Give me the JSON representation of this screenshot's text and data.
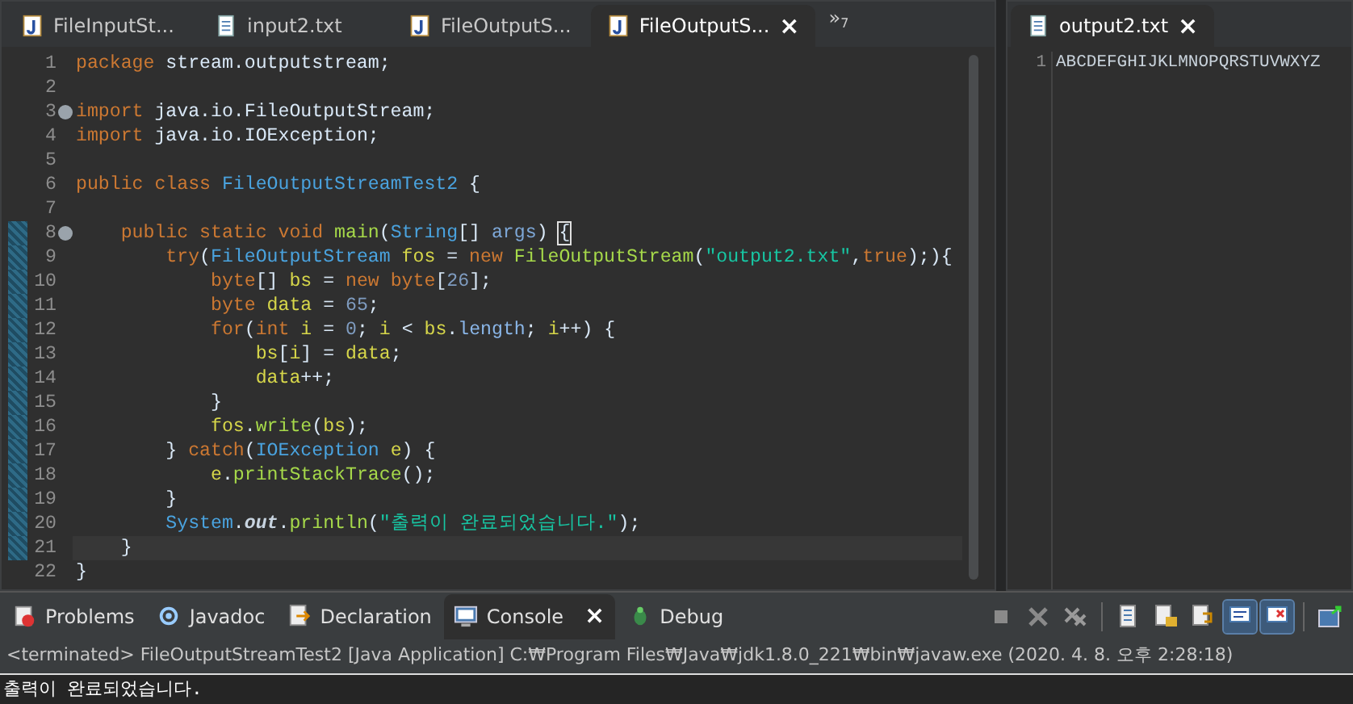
{
  "editor_tabs": [
    {
      "label": "FileInputSt...",
      "kind": "java",
      "selected": false
    },
    {
      "label": "input2.txt",
      "kind": "text",
      "selected": false
    },
    {
      "label": "FileOutputS...",
      "kind": "java",
      "selected": false
    },
    {
      "label": "FileOutputS...",
      "kind": "java",
      "selected": true,
      "close": "×"
    }
  ],
  "overflow": {
    "symbol": "»",
    "count": "7"
  },
  "editor": {
    "lines": [
      {
        "number": "1",
        "changed": false,
        "current": false,
        "fold": false,
        "tokens": [
          {
            "text": "package",
            "kind": "kw"
          },
          {
            "text": " stream.outputstream;",
            "kind": "plain"
          }
        ]
      },
      {
        "number": "2",
        "changed": false,
        "current": false,
        "fold": false
      },
      {
        "number": "3",
        "changed": false,
        "current": false,
        "fold": true,
        "tokens": [
          {
            "text": "import",
            "kind": "kw"
          },
          {
            "text": " java.io.FileOutputStream;",
            "kind": "plain"
          }
        ]
      },
      {
        "number": "4",
        "changed": false,
        "current": false,
        "fold": false,
        "tokens": [
          {
            "text": "import",
            "kind": "kw"
          },
          {
            "text": " java.io.IOException;",
            "kind": "plain"
          }
        ]
      },
      {
        "number": "5",
        "changed": false,
        "current": false,
        "fold": false
      },
      {
        "number": "6",
        "changed": false,
        "current": false,
        "fold": false,
        "tokens": [
          {
            "text": "public",
            "kind": "kw"
          },
          {
            "text": " class",
            "kind": "kw"
          },
          {
            "text": " FileOutputStreamTest2",
            "kind": "type"
          },
          {
            "text": " {",
            "kind": "plain"
          }
        ]
      },
      {
        "number": "7",
        "changed": false,
        "current": false,
        "fold": false
      },
      {
        "number": "8",
        "changed": true,
        "current": false,
        "fold": true,
        "tokens": [
          {
            "text": "    public",
            "kind": "kw"
          },
          {
            "text": " static",
            "kind": "kw"
          },
          {
            "text": " void",
            "kind": "kw"
          },
          {
            "text": " main",
            "kind": "fn"
          },
          {
            "text": "(",
            "kind": "plain"
          },
          {
            "text": "String",
            "kind": "type"
          },
          {
            "text": "[]",
            "kind": "plain"
          },
          {
            "text": " args",
            "kind": "param"
          },
          {
            "text": ") ",
            "kind": "plain"
          },
          {
            "text": "{",
            "kind": "match"
          }
        ]
      },
      {
        "number": "9",
        "changed": true,
        "current": false,
        "fold": false,
        "tokens": [
          {
            "text": "        try",
            "kind": "kw"
          },
          {
            "text": "(",
            "kind": "plain"
          },
          {
            "text": "FileOutputStream",
            "kind": "type"
          },
          {
            "text": " fos",
            "kind": "var"
          },
          {
            "text": " =",
            "kind": "plain"
          },
          {
            "text": " new",
            "kind": "kw"
          },
          {
            "text": " FileOutputStream",
            "kind": "fn"
          },
          {
            "text": "(",
            "kind": "plain"
          },
          {
            "text": "\"output2.txt\"",
            "kind": "str"
          },
          {
            "text": ",",
            "kind": "plain"
          },
          {
            "text": "true",
            "kind": "kw"
          },
          {
            "text": ");){",
            "kind": "plain"
          }
        ]
      },
      {
        "number": "10",
        "changed": true,
        "current": false,
        "fold": false,
        "tokens": [
          {
            "text": "            byte",
            "kind": "kw"
          },
          {
            "text": "[]",
            "kind": "plain"
          },
          {
            "text": " bs",
            "kind": "var"
          },
          {
            "text": " =",
            "kind": "plain"
          },
          {
            "text": " new",
            "kind": "kw"
          },
          {
            "text": " byte",
            "kind": "kw"
          },
          {
            "text": "[",
            "kind": "plain"
          },
          {
            "text": "26",
            "kind": "num"
          },
          {
            "text": "];",
            "kind": "plain"
          }
        ]
      },
      {
        "number": "11",
        "changed": true,
        "current": false,
        "fold": false,
        "tokens": [
          {
            "text": "            byte",
            "kind": "kw"
          },
          {
            "text": " data",
            "kind": "var"
          },
          {
            "text": " =",
            "kind": "plain"
          },
          {
            "text": " 65",
            "kind": "num"
          },
          {
            "text": ";",
            "kind": "plain"
          }
        ]
      },
      {
        "number": "12",
        "changed": true,
        "current": false,
        "fold": false,
        "tokens": [
          {
            "text": "            for",
            "kind": "kw"
          },
          {
            "text": "(",
            "kind": "plain"
          },
          {
            "text": "int",
            "kind": "kw"
          },
          {
            "text": " i",
            "kind": "var"
          },
          {
            "text": " =",
            "kind": "plain"
          },
          {
            "text": " 0",
            "kind": "num"
          },
          {
            "text": ";",
            "kind": "plain"
          },
          {
            "text": " i",
            "kind": "var"
          },
          {
            "text": " <",
            "kind": "plain"
          },
          {
            "text": " bs",
            "kind": "var"
          },
          {
            "text": ".",
            "kind": "plain"
          },
          {
            "text": "length",
            "kind": "field"
          },
          {
            "text": ";",
            "kind": "plain"
          },
          {
            "text": " i",
            "kind": "var"
          },
          {
            "text": "++) {",
            "kind": "plain"
          }
        ]
      },
      {
        "number": "13",
        "changed": true,
        "current": false,
        "fold": false,
        "tokens": [
          {
            "text": "                bs",
            "kind": "var"
          },
          {
            "text": "[",
            "kind": "plain"
          },
          {
            "text": "i",
            "kind": "var"
          },
          {
            "text": "] =",
            "kind": "plain"
          },
          {
            "text": " data",
            "kind": "var"
          },
          {
            "text": ";",
            "kind": "plain"
          }
        ]
      },
      {
        "number": "14",
        "changed": true,
        "current": false,
        "fold": false,
        "tokens": [
          {
            "text": "                data",
            "kind": "var"
          },
          {
            "text": "++;",
            "kind": "plain"
          }
        ]
      },
      {
        "number": "15",
        "changed": true,
        "current": false,
        "fold": false,
        "tokens": [
          {
            "text": "            }",
            "kind": "plain"
          }
        ]
      },
      {
        "number": "16",
        "changed": true,
        "current": false,
        "fold": false,
        "tokens": [
          {
            "text": "            fos",
            "kind": "var"
          },
          {
            "text": ".",
            "kind": "plain"
          },
          {
            "text": "write",
            "kind": "fn"
          },
          {
            "text": "(",
            "kind": "plain"
          },
          {
            "text": "bs",
            "kind": "var"
          },
          {
            "text": ");",
            "kind": "plain"
          }
        ]
      },
      {
        "number": "17",
        "changed": true,
        "current": false,
        "fold": false,
        "tokens": [
          {
            "text": "        }",
            "kind": "plain"
          },
          {
            "text": " catch",
            "kind": "kw"
          },
          {
            "text": "(",
            "kind": "plain"
          },
          {
            "text": "IOException",
            "kind": "type"
          },
          {
            "text": " e",
            "kind": "var"
          },
          {
            "text": ") {",
            "kind": "plain"
          }
        ]
      },
      {
        "number": "18",
        "changed": true,
        "current": false,
        "fold": false,
        "tokens": [
          {
            "text": "            e",
            "kind": "var"
          },
          {
            "text": ".",
            "kind": "plain"
          },
          {
            "text": "printStackTrace",
            "kind": "fn"
          },
          {
            "text": "();",
            "kind": "plain"
          }
        ]
      },
      {
        "number": "19",
        "changed": true,
        "current": false,
        "fold": false,
        "tokens": [
          {
            "text": "        }",
            "kind": "plain"
          }
        ]
      },
      {
        "number": "20",
        "changed": true,
        "current": false,
        "fold": false,
        "tokens": [
          {
            "text": "        System",
            "kind": "type"
          },
          {
            "text": ".",
            "kind": "plain"
          },
          {
            "text": "out",
            "kind": "static"
          },
          {
            "text": ".",
            "kind": "plain"
          },
          {
            "text": "println",
            "kind": "fn"
          },
          {
            "text": "(",
            "kind": "plain"
          },
          {
            "text": "\"출력이 완료되었습니다.\"",
            "kind": "str"
          },
          {
            "text": ");",
            "kind": "plain"
          }
        ]
      },
      {
        "number": "21",
        "changed": true,
        "current": true,
        "fold": false,
        "tokens": [
          {
            "text": "    }",
            "kind": "plain"
          }
        ]
      },
      {
        "number": "22",
        "changed": false,
        "current": false,
        "fold": false,
        "tokens": [
          {
            "text": "}",
            "kind": "plain"
          }
        ]
      }
    ]
  },
  "side_tab": {
    "label": "output2.txt",
    "selected": true,
    "close": "×"
  },
  "side_editor": {
    "lines": [
      {
        "number": "1",
        "text": "ABCDEFGHIJKLMNOPQRSTUVWXYZ"
      }
    ]
  },
  "bottom_tabs": [
    {
      "label": "Problems",
      "kind": "problems",
      "selected": false
    },
    {
      "label": "Javadoc",
      "kind": "javadoc",
      "selected": false
    },
    {
      "label": "Declaration",
      "kind": "declaration",
      "selected": false
    },
    {
      "label": "Console",
      "kind": "console",
      "selected": true,
      "close": "×"
    },
    {
      "label": "Debug",
      "kind": "debug",
      "selected": false
    }
  ],
  "console_toolbar": [
    {
      "kind": "stop",
      "pressed": false
    },
    {
      "kind": "remove",
      "pressed": false
    },
    {
      "kind": "remove-all",
      "pressed": false
    },
    {
      "kind": "doc",
      "pressed": false
    },
    {
      "kind": "lock",
      "pressed": false
    },
    {
      "kind": "word-wrap",
      "pressed": false
    },
    {
      "kind": "show-out",
      "pressed": true
    },
    {
      "kind": "show-err",
      "pressed": true
    },
    {
      "kind": "open",
      "pressed": false
    }
  ],
  "console": {
    "header": "<terminated> FileOutputStreamTest2 [Java Application] C:₩Program Files₩Java₩jdk1.8.0_221₩bin₩javaw.exe (2020. 4. 8. 오후 2:28:18)",
    "output": "출력이 완료되었습니다."
  }
}
